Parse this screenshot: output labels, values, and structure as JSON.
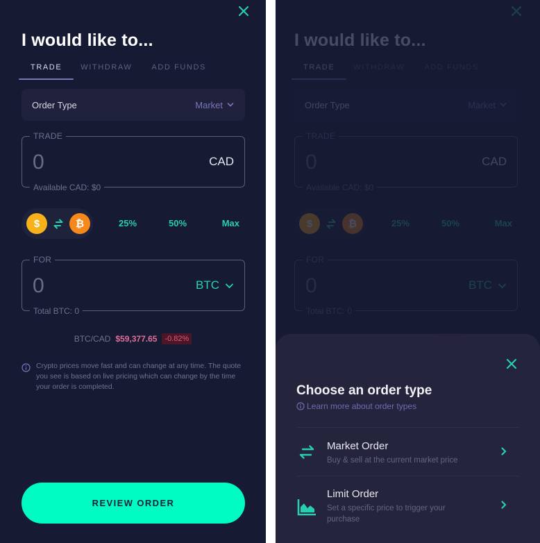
{
  "colors": {
    "background": "#161a33",
    "accent": "#00fcc3",
    "teal_text": "#27cfae",
    "purple_accent": "#7a76bb",
    "negative": "#e65873",
    "sheet_background": "#24243d"
  },
  "trade_screen": {
    "close_icon": "close-icon",
    "title": "I would like to...",
    "tabs": [
      {
        "label": "TRADE",
        "active": true
      },
      {
        "label": "WITHDRAW",
        "active": false
      },
      {
        "label": "ADD FUNDS",
        "active": false
      }
    ],
    "order_type": {
      "label": "Order Type",
      "value": "Market",
      "icon": "chevron-down-icon"
    },
    "trade_field": {
      "legend": "TRADE",
      "value": "0",
      "currency": "CAD",
      "footer": "Available CAD: $0"
    },
    "swap": {
      "from_coin": {
        "symbol": "$",
        "icon": "dollar-coin-icon"
      },
      "swap_icon": "swap-arrows-icon",
      "to_coin": {
        "symbol": "₿",
        "icon": "bitcoin-coin-icon"
      }
    },
    "quick_amounts": [
      "25%",
      "50%",
      "Max"
    ],
    "for_field": {
      "legend": "FOR",
      "value": "0",
      "currency": "BTC",
      "footer": "Total BTC: 0"
    },
    "price": {
      "pair": "BTC/CAD",
      "value": "$59,377.65",
      "change": "-0.82%"
    },
    "disclaimer": "Crypto prices move fast and can change at any time. The quote you see is based on live pricing which can change by the time your order is completed.",
    "review_button": "REVIEW ORDER"
  },
  "order_type_sheet": {
    "title": "Choose an order type",
    "learn_more": "Learn more about order types",
    "options": [
      {
        "name": "Market Order",
        "description": "Buy & sell at the current market price",
        "icon": "swap-arrows-icon"
      },
      {
        "name": "Limit Order",
        "description": "Set a specific price to trigger your purchase",
        "icon": "area-chart-icon"
      }
    ]
  }
}
